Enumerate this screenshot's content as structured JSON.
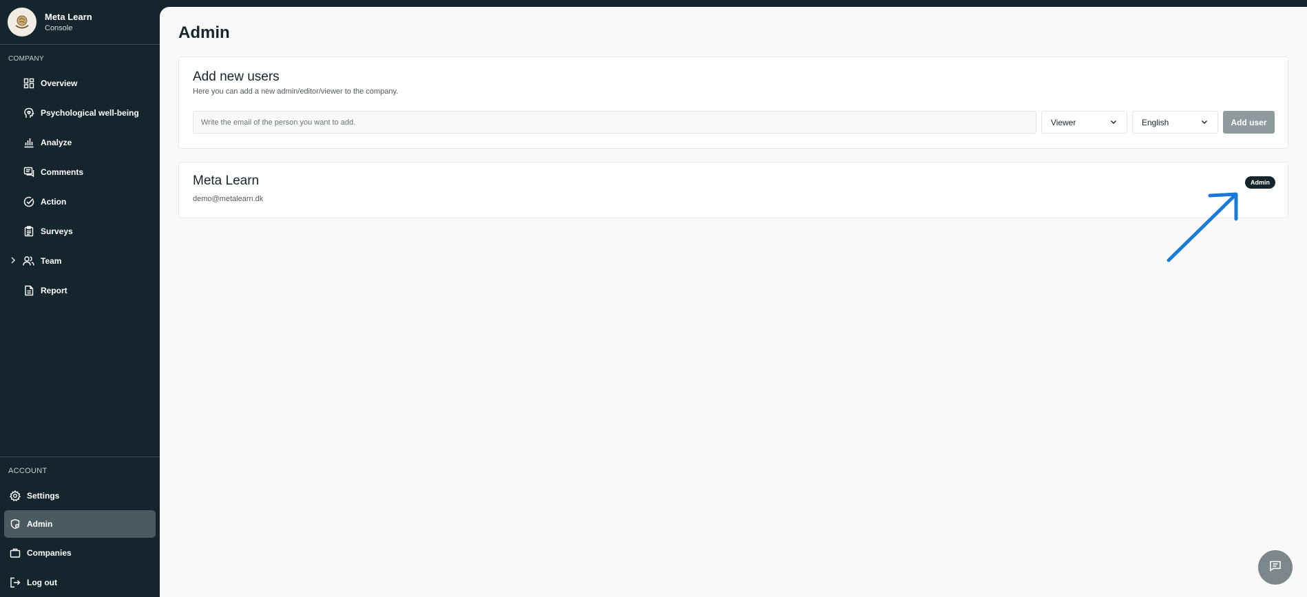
{
  "brand": {
    "name": "Meta Learn",
    "subtitle": "Console",
    "logo_icon": "brain-hand-logo"
  },
  "sidebar": {
    "company_label": "COMPANY",
    "company_items": [
      {
        "label": "Overview",
        "icon": "dashboard-icon"
      },
      {
        "label": "Psychological well-being",
        "icon": "head-heart-icon"
      },
      {
        "label": "Analyze",
        "icon": "bar-chart-icon"
      },
      {
        "label": "Comments",
        "icon": "comments-icon"
      },
      {
        "label": "Action",
        "icon": "check-circle-icon"
      },
      {
        "label": "Surveys",
        "icon": "clipboard-icon"
      },
      {
        "label": "Team",
        "icon": "users-icon",
        "expandable": true
      },
      {
        "label": "Report",
        "icon": "document-icon"
      }
    ],
    "account_label": "ACCOUNT",
    "account_items": [
      {
        "label": "Settings",
        "icon": "gear-icon"
      },
      {
        "label": "Admin",
        "icon": "shield-icon",
        "active": true
      },
      {
        "label": "Companies",
        "icon": "briefcase-icon"
      },
      {
        "label": "Log out",
        "icon": "logout-icon"
      }
    ]
  },
  "main": {
    "title": "Admin",
    "add_users": {
      "title": "Add new users",
      "subtitle": "Here you can add a new admin/editor/viewer to the company.",
      "email_placeholder": "Write the email of the person you want to add.",
      "email_value": "",
      "role_selected": "Viewer",
      "language_selected": "English",
      "add_button": "Add user"
    },
    "user_card": {
      "name": "Meta Learn",
      "email": "demo@metalearn.dk",
      "role": "Admin"
    }
  },
  "colors": {
    "sidebar_bg": "#15252d",
    "main_bg": "#f8f9f8",
    "active_item_bg": "#4b5a60",
    "add_button_bg": "#8f9a9e",
    "annotation_arrow": "#1a7bd6"
  }
}
